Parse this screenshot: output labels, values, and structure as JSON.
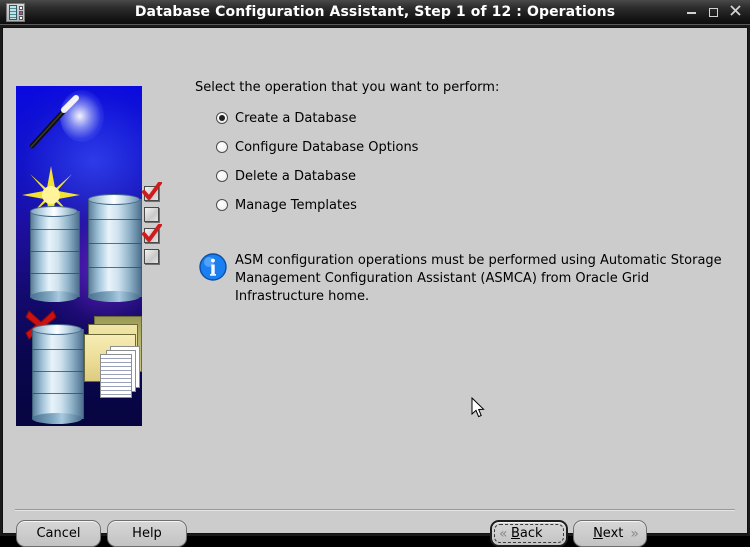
{
  "window": {
    "title": "Database Configuration Assistant, Step 1 of 12 : Operations",
    "icon_name": "dbca-app-icon",
    "controls": {
      "minimize_label": "_",
      "maximize_label": "□",
      "close_label": "✕"
    }
  },
  "colors": {
    "titlebar_dark": "#161616",
    "client_background": "#cccccc",
    "panel_blue": "#1010c8",
    "info_icon_blue": "#1878e8",
    "accent_red": "#d42020",
    "text": "#000000"
  },
  "main": {
    "prompt": "Select the operation that you want to perform:",
    "options": [
      {
        "label": "Create a Database",
        "selected": true
      },
      {
        "label": "Configure Database Options",
        "selected": false
      },
      {
        "label": "Delete a Database",
        "selected": false
      },
      {
        "label": "Manage Templates",
        "selected": false
      }
    ],
    "info": {
      "icon_name": "information-icon",
      "line1": "ASM configuration operations must be performed using Automatic Storage",
      "line2": "Management Configuration Assistant (ASMCA) from Oracle Grid Infrastructure home."
    }
  },
  "sidebar_graphic": {
    "name": "dbca-wizard-illustration",
    "elements": [
      "magic-wand",
      "sparkle-star",
      "database-cylinder",
      "checklist-with-red-checkmarks",
      "red-x-over-database",
      "folder-with-documents"
    ]
  },
  "footer": {
    "cancel_label": "Cancel",
    "help_label": "Help",
    "back": {
      "label": "Back",
      "mnemonic": "B",
      "chevron": "«",
      "focused": true
    },
    "next": {
      "label": "Next",
      "mnemonic": "N",
      "chevron": "»",
      "focused": false
    }
  }
}
